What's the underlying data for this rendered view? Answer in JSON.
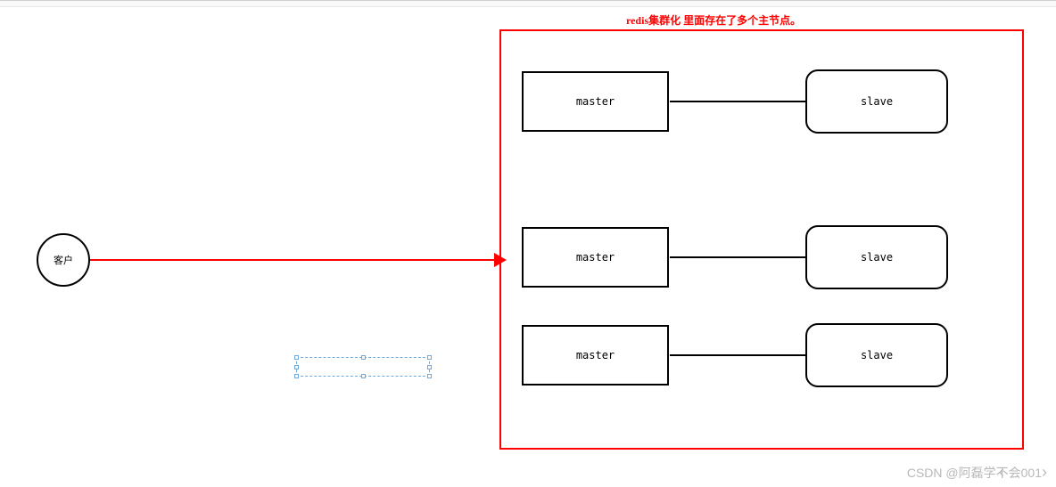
{
  "title": "redis集群化 里面存在了多个主节点。",
  "client_label": "客户",
  "rows": [
    {
      "master": "master",
      "slave": "slave"
    },
    {
      "master": "master",
      "slave": "slave"
    },
    {
      "master": "master",
      "slave": "slave"
    }
  ],
  "watermark": "CSDN @阿磊学不会001",
  "nav": {
    "left": "‹",
    "right": "›"
  }
}
